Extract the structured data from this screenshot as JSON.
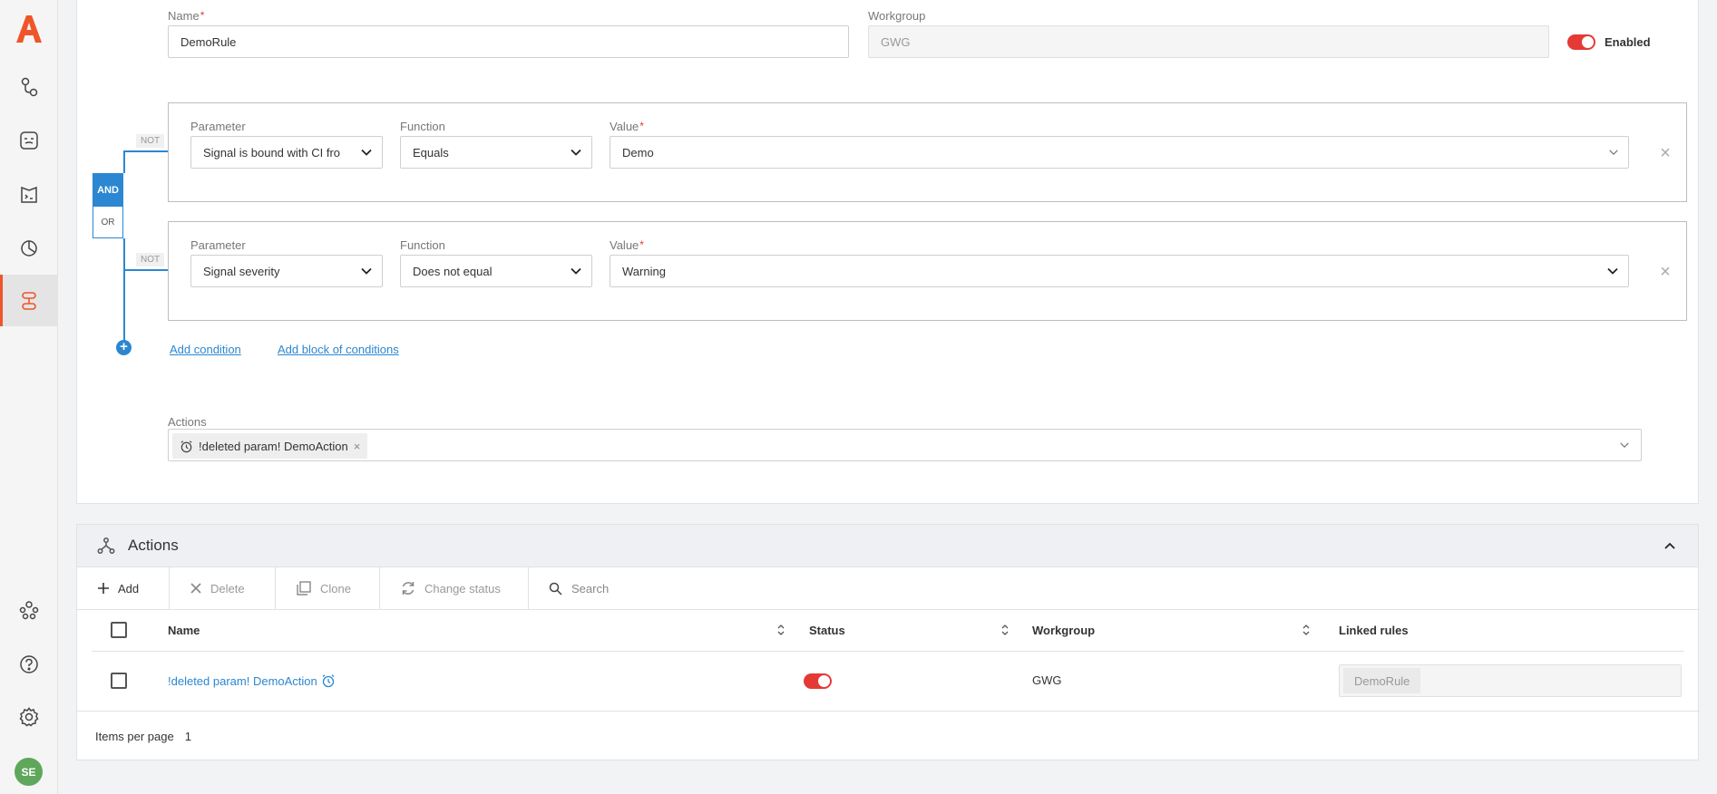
{
  "sidebar": {
    "logo_icon": "brand-logo-icon",
    "items": [
      {
        "name": "workflow-icon"
      },
      {
        "name": "monitor-icon"
      },
      {
        "name": "inventory-icon"
      },
      {
        "name": "reports-icon"
      },
      {
        "name": "rules-icon",
        "active": true
      }
    ],
    "bottom_items": [
      {
        "name": "users-icon"
      },
      {
        "name": "help-icon"
      },
      {
        "name": "settings-icon"
      }
    ],
    "avatar_initials": "SE"
  },
  "form": {
    "name_label": "Name",
    "name_value": "DemoRule",
    "workgroup_label": "Workgroup",
    "workgroup_value": "GWG",
    "enabled_label": "Enabled"
  },
  "conditions": {
    "and_label": "AND",
    "or_label": "OR",
    "not_label": "NOT",
    "rows": [
      {
        "parameter_label": "Parameter",
        "parameter_value": "Signal is bound with CI fro",
        "function_label": "Function",
        "function_value": "Equals",
        "value_label": "Value",
        "value_value": "Demo"
      },
      {
        "parameter_label": "Parameter",
        "parameter_value": "Signal severity",
        "function_label": "Function",
        "function_value": "Does not equal",
        "value_label": "Value",
        "value_value": "Warning"
      }
    ],
    "add_condition": "Add condition",
    "add_block": "Add block of conditions"
  },
  "actions_field": {
    "label": "Actions",
    "chip": "!deleted param! DemoAction",
    "chip_remove": "×"
  },
  "actions_section": {
    "title": "Actions",
    "toolbar": {
      "add": "Add",
      "delete": "Delete",
      "clone": "Clone",
      "change_status": "Change status",
      "search": "Search"
    },
    "columns": [
      "Name",
      "Status",
      "Workgroup",
      "Linked rules"
    ],
    "rows": [
      {
        "name": "!deleted param! DemoAction",
        "status_enabled": true,
        "workgroup": "GWG",
        "linked_rules": "DemoRule"
      }
    ],
    "footer": {
      "items_per_page_label": "Items per page",
      "items_per_page_value": "1"
    }
  },
  "colors": {
    "accent": "#f0552a",
    "link": "#2b87d1",
    "toggle_on": "#e53935",
    "avatar": "#5fa75a"
  }
}
